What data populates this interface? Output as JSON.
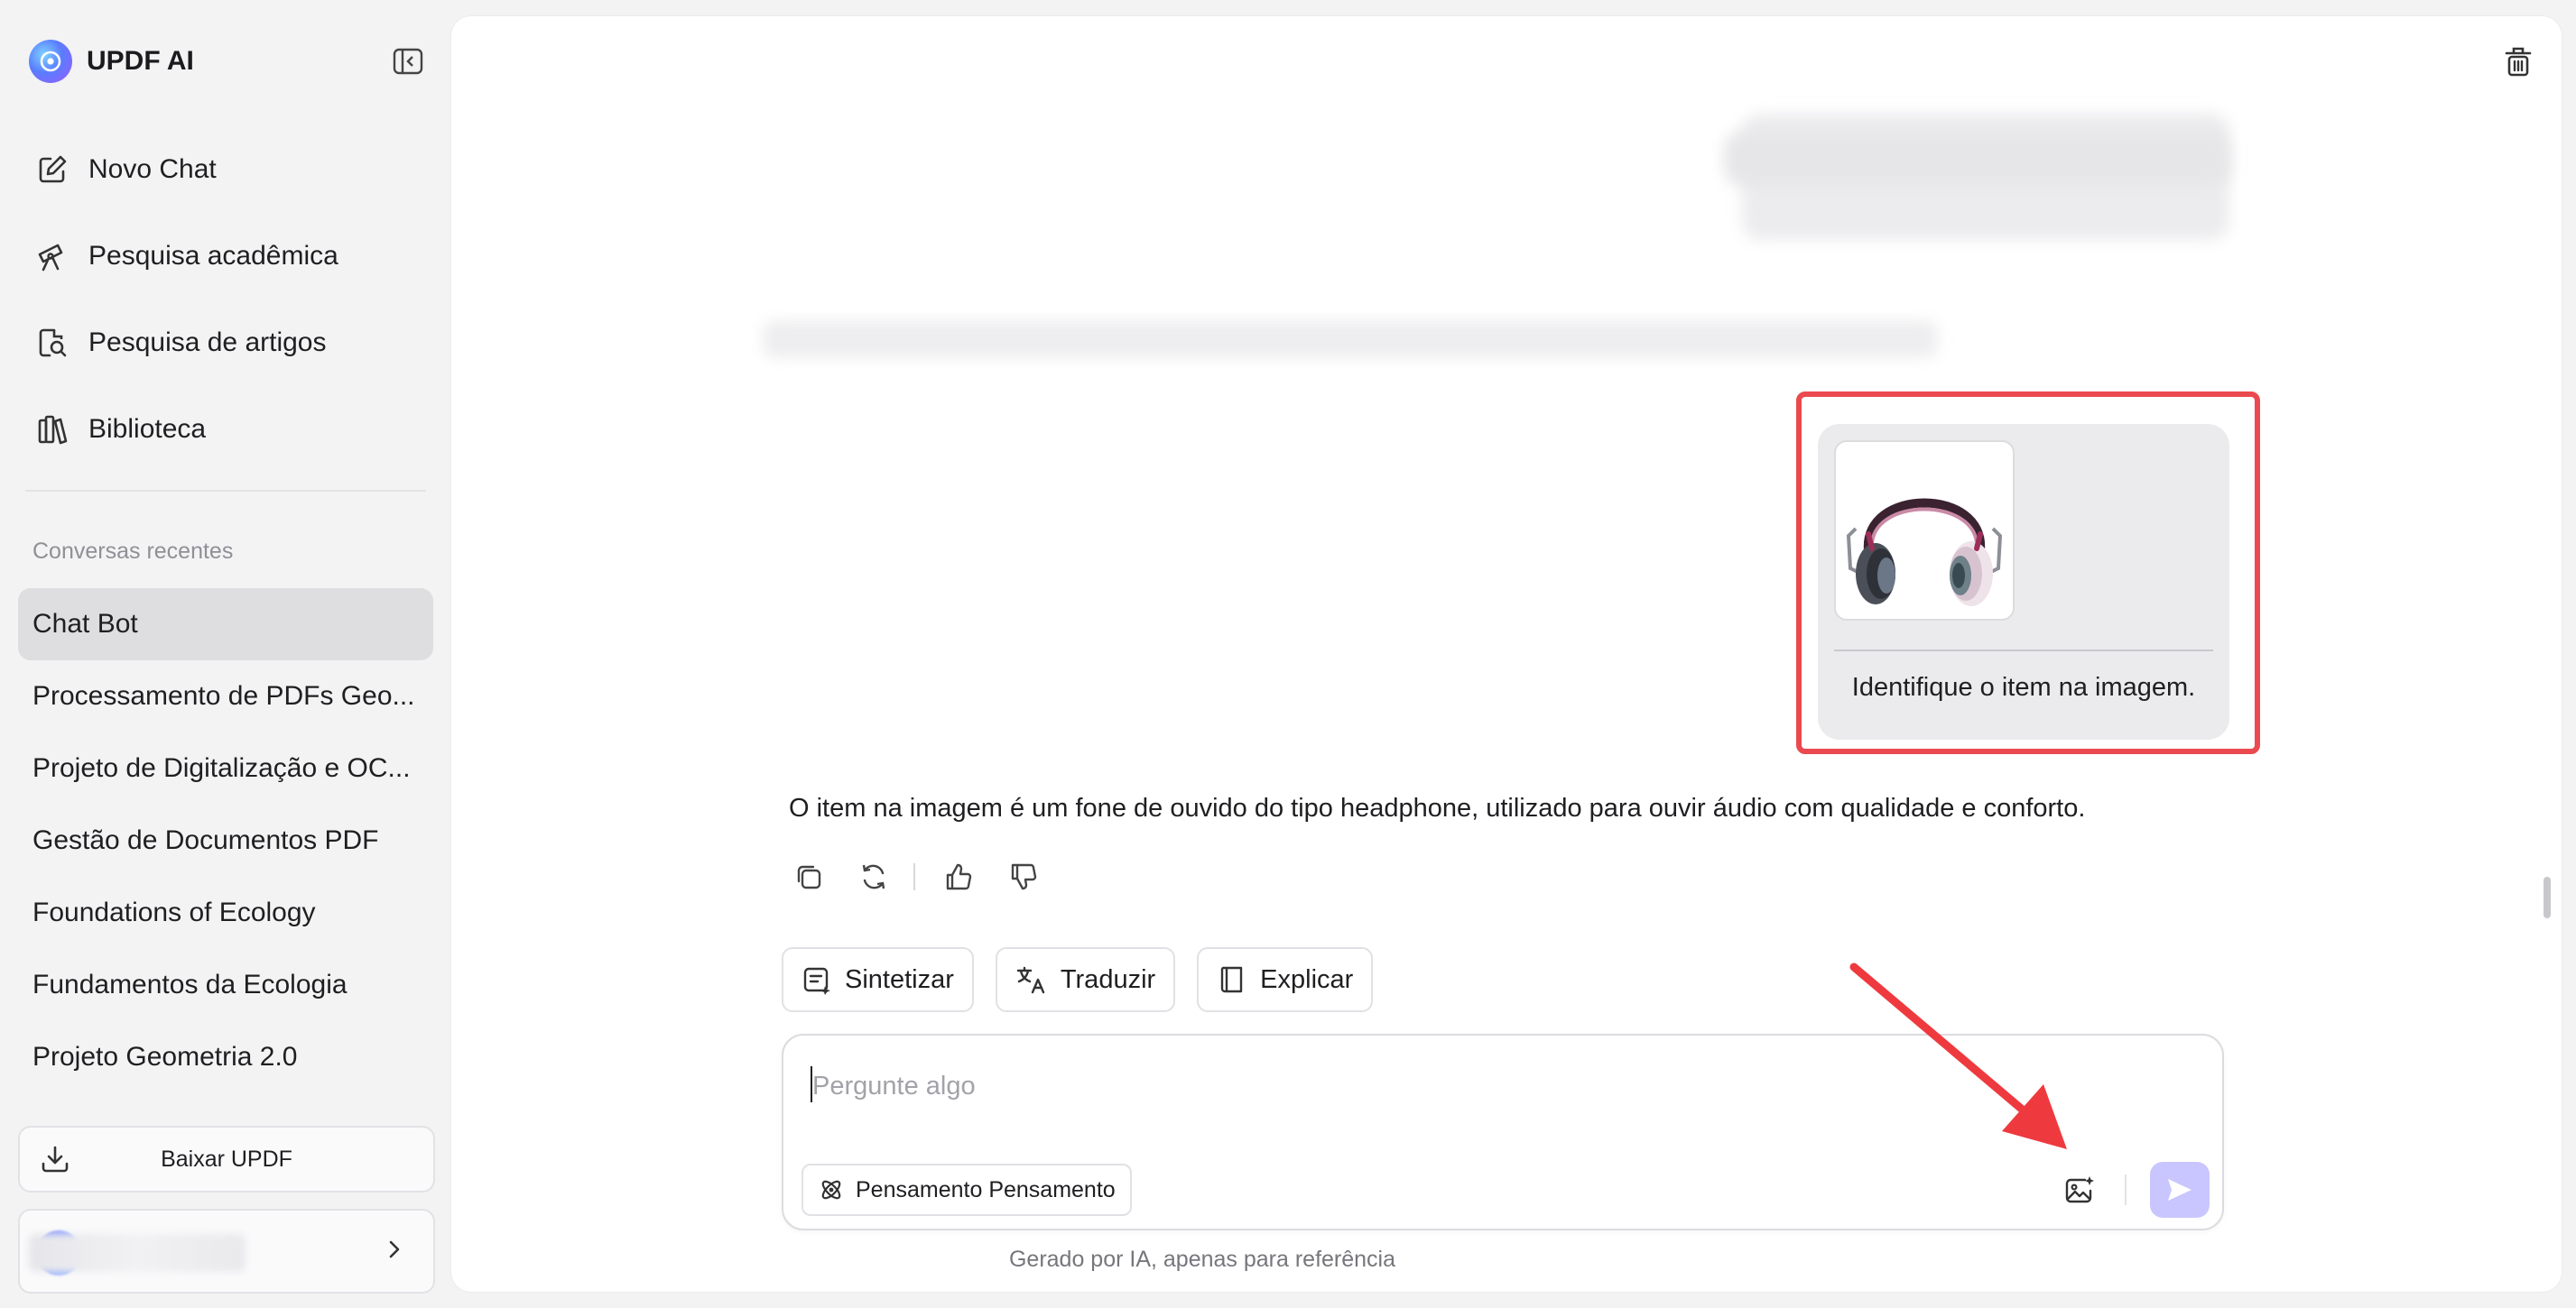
{
  "brand": {
    "name": "UPDF AI"
  },
  "nav": {
    "items": [
      {
        "label": "Novo Chat",
        "icon": "edit-icon"
      },
      {
        "label": "Pesquisa acadêmica",
        "icon": "telescope-icon"
      },
      {
        "label": "Pesquisa de artigos",
        "icon": "doc-search-icon"
      },
      {
        "label": "Biblioteca",
        "icon": "library-icon"
      }
    ]
  },
  "recent": {
    "label": "Conversas recentes",
    "items": [
      "Chat Bot",
      "Processamento de PDFs Geo...",
      "Projeto de Digitalização e OC...",
      "Gestão de Documentos PDF",
      "Foundations of Ecology",
      "Fundamentos da Ecologia",
      "Projeto Geometria 2.0"
    ],
    "active_index": 0
  },
  "download": {
    "label": "Baixar UPDF"
  },
  "chat": {
    "user_message": "Identifique o item na imagem.",
    "answer": "O item na imagem é um fone de ouvido do tipo headphone, utilizado para ouvir áudio com qualidade e conforto."
  },
  "chips": [
    {
      "label": "Sintetizar",
      "icon": "summarize-icon"
    },
    {
      "label": "Traduzir",
      "icon": "translate-icon"
    },
    {
      "label": "Explicar",
      "icon": "book-icon"
    }
  ],
  "composer": {
    "placeholder": "Pergunte algo",
    "think_label": "Pensamento Pensamento"
  },
  "footer": {
    "note": "Gerado por IA, apenas para referência"
  },
  "colors": {
    "accent": "#c9c6ff",
    "highlight": "#ea4a4f",
    "active_item": "#dedee1"
  }
}
